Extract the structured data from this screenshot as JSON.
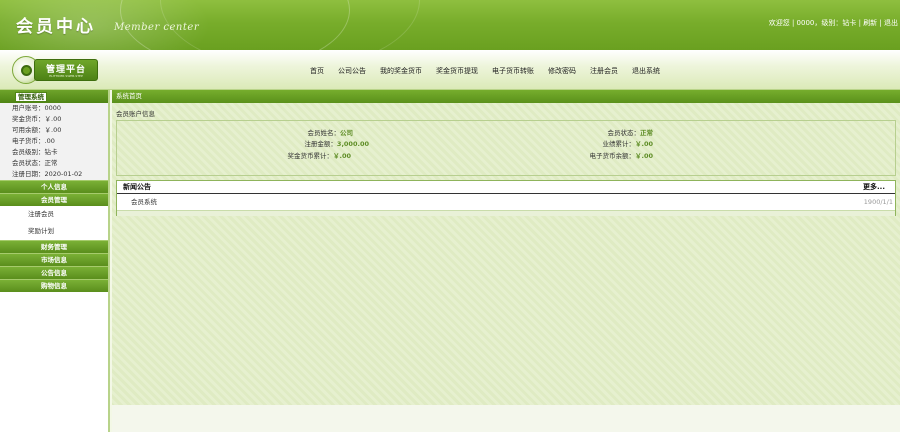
{
  "header": {
    "title": "会员中心",
    "subtitle": "Member center",
    "welcome": "欢迎您",
    "user_id": "0000",
    "level_prefix": "级别：",
    "level": "钻卡",
    "refresh": "刷新",
    "logout": "退出"
  },
  "logo": {
    "text": "管理平台",
    "sub": "ELITTIDER SWEB-STEP"
  },
  "nav": [
    "首页",
    "公司公告",
    "我的奖金货币",
    "奖金货币提现",
    "电子货币转账",
    "修改密码",
    "注册会员",
    "退出系统"
  ],
  "sidebar": {
    "head": "管理系统",
    "info": [
      "用户账号：0000",
      "奖金货币：￥.00",
      "可用余额：￥.00",
      "电子货币：.00",
      "会员级别：钻卡",
      "会员状态：正常",
      "注册日期：2020-01-02"
    ],
    "menus_top": [
      "个人信息",
      "会员管理"
    ],
    "sub_items": [
      "注册会员",
      "奖励计划"
    ],
    "menus_bottom": [
      "财务管理",
      "市场信息",
      "公告信息",
      "购物信息"
    ]
  },
  "main": {
    "crumb": "系统首页",
    "section": "会员账户信息",
    "left_rows": [
      {
        "k": "会员姓名：",
        "v": "公司"
      },
      {
        "k": "注册金额：",
        "v": "3,000.00"
      },
      {
        "k": "奖金货币累计：",
        "v": "￥.00"
      }
    ],
    "right_rows": [
      {
        "k": "会员状态：",
        "v": "正常"
      },
      {
        "k": "业绩累计：",
        "v": "￥.00"
      },
      {
        "k": "电子货币余额：",
        "v": "￥.00"
      }
    ],
    "news": {
      "title": "新闻公告",
      "more": "更多...",
      "items": [
        {
          "title": "会员系统",
          "date": "1900/1/1"
        }
      ]
    }
  }
}
